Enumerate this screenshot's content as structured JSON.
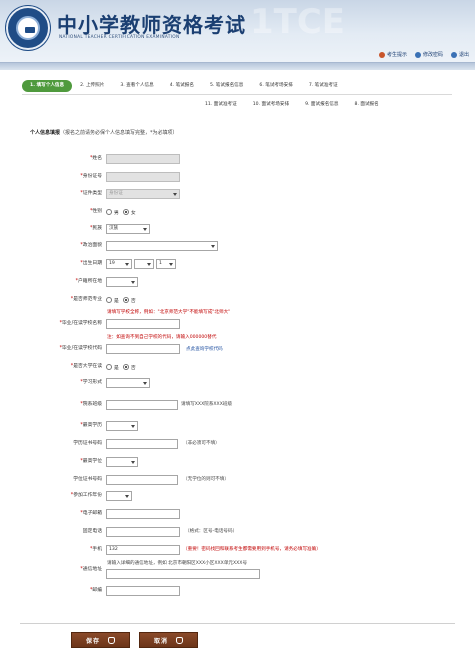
{
  "header": {
    "title": "中小学教师资格考试",
    "subtitle": "NATIONAL TEACHER CERTIFICATION EXAMINATION",
    "watermark": "1TCE",
    "links": [
      {
        "label": "考生提示",
        "icon": "info-icon"
      },
      {
        "label": "修改密码",
        "icon": "key-icon"
      },
      {
        "label": "退出",
        "icon": "logout-icon"
      }
    ]
  },
  "steps": {
    "row1": [
      "1. 填写个人信息",
      "2. 上传照片",
      "3. 查看个人信息",
      "4. 笔试报名",
      "5. 笔试报名信息",
      "6. 笔试考场安排",
      "7. 笔试准考证"
    ],
    "row2": [
      "11. 面试准考证",
      "10. 面试考场安排",
      "9. 面试报名信息",
      "8. 面试报名"
    ]
  },
  "form": {
    "section_title": "个人信息填报",
    "section_note": "（报名之前请务必保个人信息填写完整，*为必填项）",
    "name": {
      "label": "姓名",
      "value": ""
    },
    "id_number": {
      "label": "身份证号",
      "value": ""
    },
    "id_type": {
      "label": "证件类型",
      "value": "身份证"
    },
    "gender": {
      "label": "性别",
      "options": [
        "男",
        "女"
      ],
      "selected": "女"
    },
    "ethnicity": {
      "label": "民族",
      "value": "汉族"
    },
    "political": {
      "label": "政治面貌",
      "value": ""
    },
    "birth": {
      "label": "出生日期",
      "year": "19",
      "month": "",
      "day": "1"
    },
    "hukou": {
      "label": "户籍所在地",
      "value": ""
    },
    "is_normal": {
      "label": "是否师范专业",
      "options": [
        "是",
        "否"
      ],
      "selected": "否"
    },
    "school_name": {
      "label": "毕业/在读学校名称",
      "hint": "请填写学校全称，例如：\"北京师范大学\"不能填写成\"北师大\""
    },
    "school_code": {
      "label": "毕业/在读学校代码",
      "hint": "注：如查询不到自己学校的代码，请输入000000替代",
      "link": "点此查询学校代码"
    },
    "is_student": {
      "label": "是否大学在读",
      "options": [
        "是",
        "否"
      ],
      "selected": "否"
    },
    "study_form": {
      "label": "学习形式",
      "value": ""
    },
    "dept": {
      "label": "院系班级",
      "hint": "请填写XXX院系XXX班级"
    },
    "edu": {
      "label": "最高学历",
      "value": ""
    },
    "edu_cert": {
      "label": "学历证书号码",
      "hint": "（非必须可不填）"
    },
    "degree": {
      "label": "最高学位",
      "value": ""
    },
    "degree_cert": {
      "label": "学位证书号码",
      "hint": "（无学位的则可不填）"
    },
    "work_year": {
      "label": "参加工作年份",
      "value": ""
    },
    "email": {
      "label": "电子邮箱",
      "value": ""
    },
    "phone": {
      "label": "固定电话",
      "hint": "（格式：区号-电话号码）"
    },
    "mobile": {
      "label": "手机",
      "value": "132",
      "hint": "（重要！密码找回和联系考生都需要用到手机号，请务必填写准确）"
    },
    "address": {
      "label": "通信地址",
      "hint": "请输入详细的通信地址，例如 北京市朝阳区XXX小区XXX单元XXX号"
    },
    "postcode": {
      "label": "邮编",
      "value": ""
    }
  },
  "buttons": {
    "save": "保存",
    "cancel": "取消"
  },
  "colors": {
    "brand": "#1f4c86",
    "active_step": "#4f9a3d",
    "button": "#7a3f20",
    "required": "#c00000"
  }
}
